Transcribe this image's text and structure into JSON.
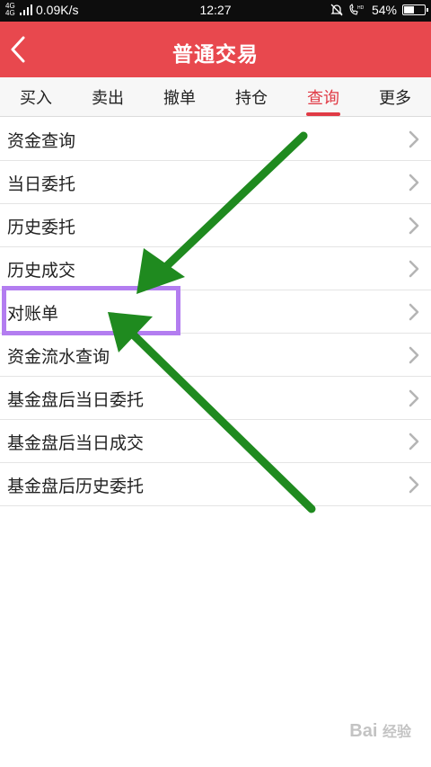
{
  "status_bar": {
    "network_type": "4G 4G",
    "speed": "0.09K/s",
    "time": "12:27",
    "battery": "54%",
    "battery_level": 0.54,
    "icons": [
      "signal-icon",
      "mute-icon",
      "volte-icon",
      "battery-icon"
    ]
  },
  "header": {
    "title": "普通交易",
    "back_icon": "chevron-left-icon",
    "background": "#e8484e"
  },
  "tabs": [
    {
      "label": "买入",
      "active": false
    },
    {
      "label": "卖出",
      "active": false
    },
    {
      "label": "撤单",
      "active": false
    },
    {
      "label": "持仓",
      "active": false
    },
    {
      "label": "查询",
      "active": true
    },
    {
      "label": "更多",
      "active": false
    }
  ],
  "menu_items": [
    {
      "label": "资金查询"
    },
    {
      "label": "当日委托"
    },
    {
      "label": "历史委托"
    },
    {
      "label": "历史成交"
    },
    {
      "label": "对账单"
    },
    {
      "label": "资金流水查询"
    },
    {
      "label": "基金盘后当日委托"
    },
    {
      "label": "基金盘后当日成交"
    },
    {
      "label": "基金盘后历史委托"
    }
  ],
  "annotations": {
    "highlight_color": "#b37df0",
    "arrow_color": "#1f8a1f"
  },
  "watermark": {
    "text": "Bai",
    "sub": "经验"
  },
  "colors": {
    "accent": "#e03a45",
    "text": "#222222",
    "divider": "#e4e4e4"
  }
}
